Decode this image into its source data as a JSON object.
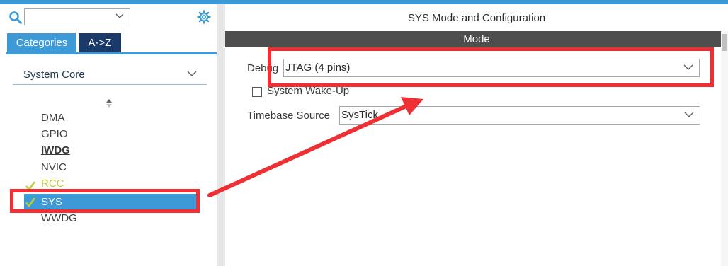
{
  "left_panel": {
    "tabs": [
      {
        "label": "Categories"
      },
      {
        "label": "A->Z"
      }
    ],
    "category_select": {
      "value": "System Core"
    },
    "items": [
      {
        "label": "DMA"
      },
      {
        "label": "GPIO"
      },
      {
        "label": "IWDG"
      },
      {
        "label": "NVIC"
      },
      {
        "label": "RCC"
      },
      {
        "label": "SYS"
      },
      {
        "label": "WWDG"
      }
    ]
  },
  "right_panel": {
    "title": "SYS Mode and Configuration",
    "section_header": "Mode",
    "debug": {
      "label": "Debug",
      "value": "JTAG (4 pins)"
    },
    "wakeup": {
      "label": "System Wake-Up",
      "checked": false
    },
    "timebase": {
      "label": "Timebase Source",
      "value": "SysTick"
    }
  },
  "colors": {
    "accent": "#3d9ad6",
    "tab_dark": "#1a3a6a",
    "mode_bar": "#4e4e4e",
    "highlight_red": "#ee3035",
    "check_green": "#b8cc3a"
  },
  "icons": [
    "search-icon",
    "gear-icon",
    "chevron-down-icon",
    "sort-icon",
    "check-icon"
  ]
}
